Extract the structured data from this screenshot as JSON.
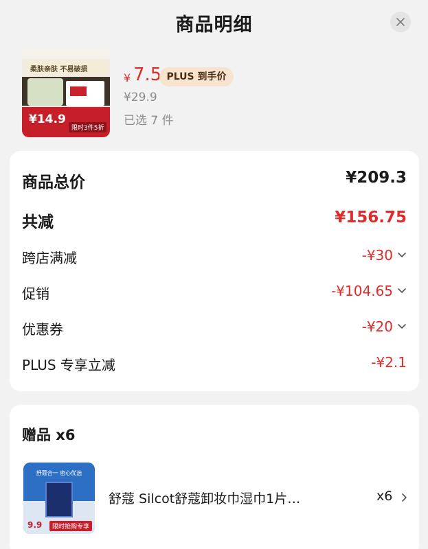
{
  "header": {
    "title": "商品明细"
  },
  "product": {
    "thumb": {
      "slogan": "柔肤亲肤 不易破损",
      "price": "¥14.9",
      "deal": "限时3件5折"
    },
    "price_symbol": "¥",
    "price_value": "7.5",
    "plus_badge": "PLUS 到手价",
    "original_price": "¥29.9",
    "selected_count": "已选 7 件"
  },
  "summary": {
    "total_label": "商品总价",
    "total_value": "¥209.3",
    "reduce_label": "共减",
    "reduce_value": "¥156.75",
    "items": [
      {
        "label": "跨店满减",
        "value": "-¥30"
      },
      {
        "label": "促销",
        "value": "-¥104.65"
      },
      {
        "label": "优惠券",
        "value": "-¥20"
      },
      {
        "label": "PLUS 专享立减",
        "value": "-¥2.1"
      }
    ]
  },
  "gifts": {
    "title": "赠品 x6",
    "item": {
      "thumb_header": "舒蔻合一 密心优选",
      "thumb_price": "9.9",
      "thumb_tag": "限时抢购专享",
      "name": "舒蔻 Silcot舒蔻卸妆巾湿巾1片…",
      "quantity": "x6"
    }
  },
  "colors": {
    "accent_red": "#e02b2b",
    "plus_badge_bg": "#f7e3cf",
    "page_bg": "#f2f2f2"
  },
  "icons": [
    "close-icon",
    "chevron-down-icon",
    "chevron-right-icon"
  ]
}
